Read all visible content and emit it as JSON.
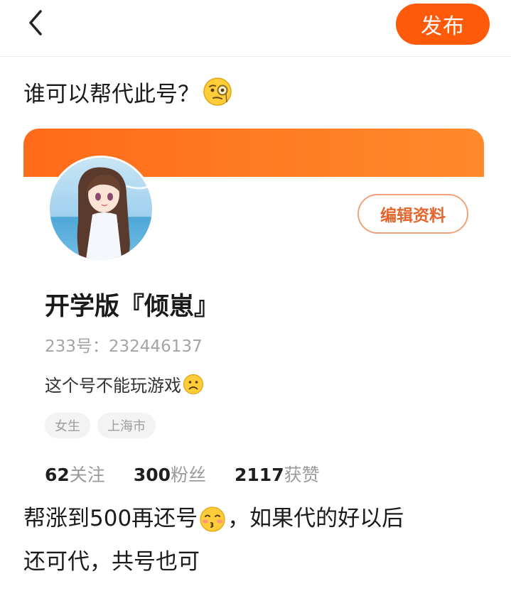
{
  "header": {
    "back_icon": "chevron-left-icon",
    "publish_label": "发布",
    "accent_color": "#ff5a0a"
  },
  "post": {
    "title": "谁可以帮代此号？",
    "title_emoji": "monocle-face-emoji",
    "body_line1_a": "帮涨到500再还号",
    "body_line1_emoji": "kissing-face-emoji",
    "body_line1_b": "，如果代的好以后",
    "body_line2": "还可代，共号也可"
  },
  "profile_card": {
    "edit_label": "编辑资料",
    "nickname": "开学版『倾崽』",
    "uid": "233号：232446137",
    "bio": "这个号不能玩游戏",
    "bio_emoji": "frowning-face-emoji",
    "tags": [
      "女生",
      "上海市"
    ],
    "stats": [
      {
        "num": "62",
        "label": "关注"
      },
      {
        "num": "300",
        "label": "粉丝"
      },
      {
        "num": "2117",
        "label": "获赞"
      }
    ]
  }
}
